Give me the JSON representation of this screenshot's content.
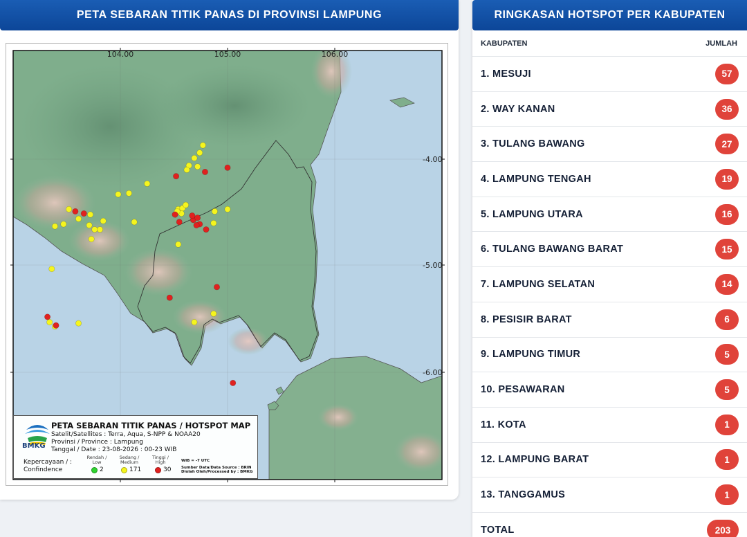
{
  "map_panel": {
    "title": "PETA SEBARAN TITIK PANAS DI PROVINSI LAMPUNG",
    "axes": {
      "lon_labels": [
        "104.00",
        "105.00",
        "106.00"
      ],
      "lat_labels": [
        "-4.00",
        "-5.00",
        "-6.00"
      ]
    },
    "hotspots": {
      "yellow": [
        [
          104.77,
          -3.87
        ],
        [
          104.74,
          -3.94
        ],
        [
          104.69,
          -3.99
        ],
        [
          104.64,
          -4.06
        ],
        [
          104.72,
          -4.07
        ],
        [
          104.62,
          -4.1
        ],
        [
          104.25,
          -4.23
        ],
        [
          104.08,
          -4.32
        ],
        [
          103.98,
          -4.33
        ],
        [
          104.54,
          -4.47
        ],
        [
          104.58,
          -4.46
        ],
        [
          104.61,
          -4.43
        ],
        [
          104.57,
          -4.51
        ],
        [
          104.53,
          -4.49
        ],
        [
          104.88,
          -4.49
        ],
        [
          105.0,
          -4.47
        ],
        [
          104.87,
          -4.6
        ],
        [
          103.52,
          -4.47
        ],
        [
          103.72,
          -4.52
        ],
        [
          103.61,
          -4.56
        ],
        [
          103.47,
          -4.61
        ],
        [
          103.39,
          -4.63
        ],
        [
          103.71,
          -4.62
        ],
        [
          103.73,
          -4.75
        ],
        [
          103.76,
          -4.66
        ],
        [
          103.84,
          -4.58
        ],
        [
          104.13,
          -4.59
        ],
        [
          103.81,
          -4.66
        ],
        [
          104.54,
          -4.8
        ],
        [
          103.36,
          -5.03
        ],
        [
          103.34,
          -5.53
        ],
        [
          103.39,
          -5.57
        ],
        [
          103.61,
          -5.54
        ],
        [
          104.69,
          -5.53
        ],
        [
          104.87,
          -5.45
        ]
      ],
      "red": [
        [
          104.79,
          -4.12
        ],
        [
          105.0,
          -4.08
        ],
        [
          104.52,
          -4.16
        ],
        [
          103.58,
          -4.49
        ],
        [
          103.66,
          -4.51
        ],
        [
          104.55,
          -4.59
        ],
        [
          104.68,
          -4.57
        ],
        [
          104.72,
          -4.55
        ],
        [
          104.74,
          -4.61
        ],
        [
          104.8,
          -4.66
        ],
        [
          104.51,
          -4.52
        ],
        [
          104.67,
          -4.53
        ],
        [
          104.71,
          -4.62
        ],
        [
          104.9,
          -5.2
        ],
        [
          104.46,
          -5.3
        ],
        [
          103.32,
          -5.48
        ],
        [
          103.4,
          -5.56
        ],
        [
          105.05,
          -6.1
        ]
      ],
      "green": []
    },
    "legend": {
      "title": "PETA SEBARAN TITIK PANAS / HOTSPOT MAP",
      "satellite": "Satelit/Satellites : Terra, Aqua, S-NPP & NOAA20",
      "province": "Provinsi / Province : Lampung",
      "date": "Tanggal / Date : 23-08-2026 : 00-23 WIB",
      "logo_text": "BMKG",
      "confidence_label": "Kepercayaan / :\nConfindence",
      "low_label": "Rendah /\nLow",
      "medium_label": "Sedang /\nMedium",
      "high_label": "Tinggi /\nHigh",
      "low_count": "2",
      "medium_count": "171",
      "high_count": "30",
      "wib_note": "WIB = -7 UTC",
      "source_note": "Sumber Data/Data Source : BRIN",
      "processed_note": "Diolah Oleh/Processed by   : BMKG",
      "colors": {
        "low": "#2fd42f",
        "medium": "#f5f51e",
        "high": "#e0211f"
      }
    }
  },
  "summary_panel": {
    "title": "RINGKASAN HOTSPOT PER KABUPATEN",
    "col_kabupaten": "KABUPATEN",
    "col_jumlah": "JUMLAH",
    "rows": [
      {
        "name": "1. MESUJI",
        "count": "57"
      },
      {
        "name": "2. WAY KANAN",
        "count": "36"
      },
      {
        "name": "3. TULANG BAWANG",
        "count": "27"
      },
      {
        "name": "4. LAMPUNG TENGAH",
        "count": "19"
      },
      {
        "name": "5. LAMPUNG UTARA",
        "count": "16"
      },
      {
        "name": "6. TULANG BAWANG BARAT",
        "count": "15"
      },
      {
        "name": "7. LAMPUNG SELATAN",
        "count": "14"
      },
      {
        "name": "8. PESISIR BARAT",
        "count": "6"
      },
      {
        "name": "9. LAMPUNG TIMUR",
        "count": "5"
      },
      {
        "name": "10. PESAWARAN",
        "count": "5"
      },
      {
        "name": "11. KOTA",
        "count": "1"
      },
      {
        "name": "12. LAMPUNG BARAT",
        "count": "1"
      },
      {
        "name": "13. TANGGAMUS",
        "count": "1"
      }
    ],
    "total_label": "TOTAL",
    "total_count": "203",
    "badge_color": "#e0433a"
  }
}
